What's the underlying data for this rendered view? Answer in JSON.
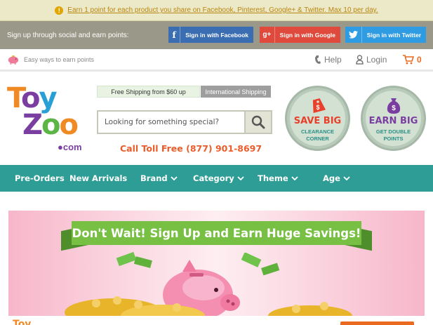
{
  "notice": {
    "text": "Earn 1 point for each product you share on Facebook, Pinterest, Google+ & Twitter. Max 10 per day."
  },
  "social": {
    "label": "Sign up through social and earn points:",
    "facebook": "Sign in with Facebook",
    "google": "Sign in with Google",
    "twitter": "Sign in with Twitter"
  },
  "util": {
    "earn_link": "Easy ways to earn points",
    "help": "Help",
    "login": "Login",
    "cart_count": "0"
  },
  "logo": {
    "line1": [
      "T",
      "o",
      "y"
    ],
    "line2": [
      "Z",
      "o",
      "o"
    ],
    "dotcom": "●com"
  },
  "shipping": {
    "free": "Free Shipping from $60 up",
    "intl": "International Shipping"
  },
  "search": {
    "placeholder": "Looking for something special?"
  },
  "phone": "Call Toll Free (877) 901-8697",
  "badges": {
    "save": {
      "title": "SAVE BIG",
      "sub": "CLEARANCE CORNER"
    },
    "earn": {
      "title": "EARN BIG",
      "sub": "GET DOUBLE POINTS"
    }
  },
  "nav": [
    "Pre-Orders",
    "New Arrivals",
    "Brand",
    "Category",
    "Theme",
    "Age"
  ],
  "banner": {
    "headline": "Don't Wait! Sign Up and Earn Huge Savings!"
  },
  "colors": {
    "teal": "#2e9d95",
    "orange": "#ea6a21",
    "ribbon": "#77c043"
  }
}
